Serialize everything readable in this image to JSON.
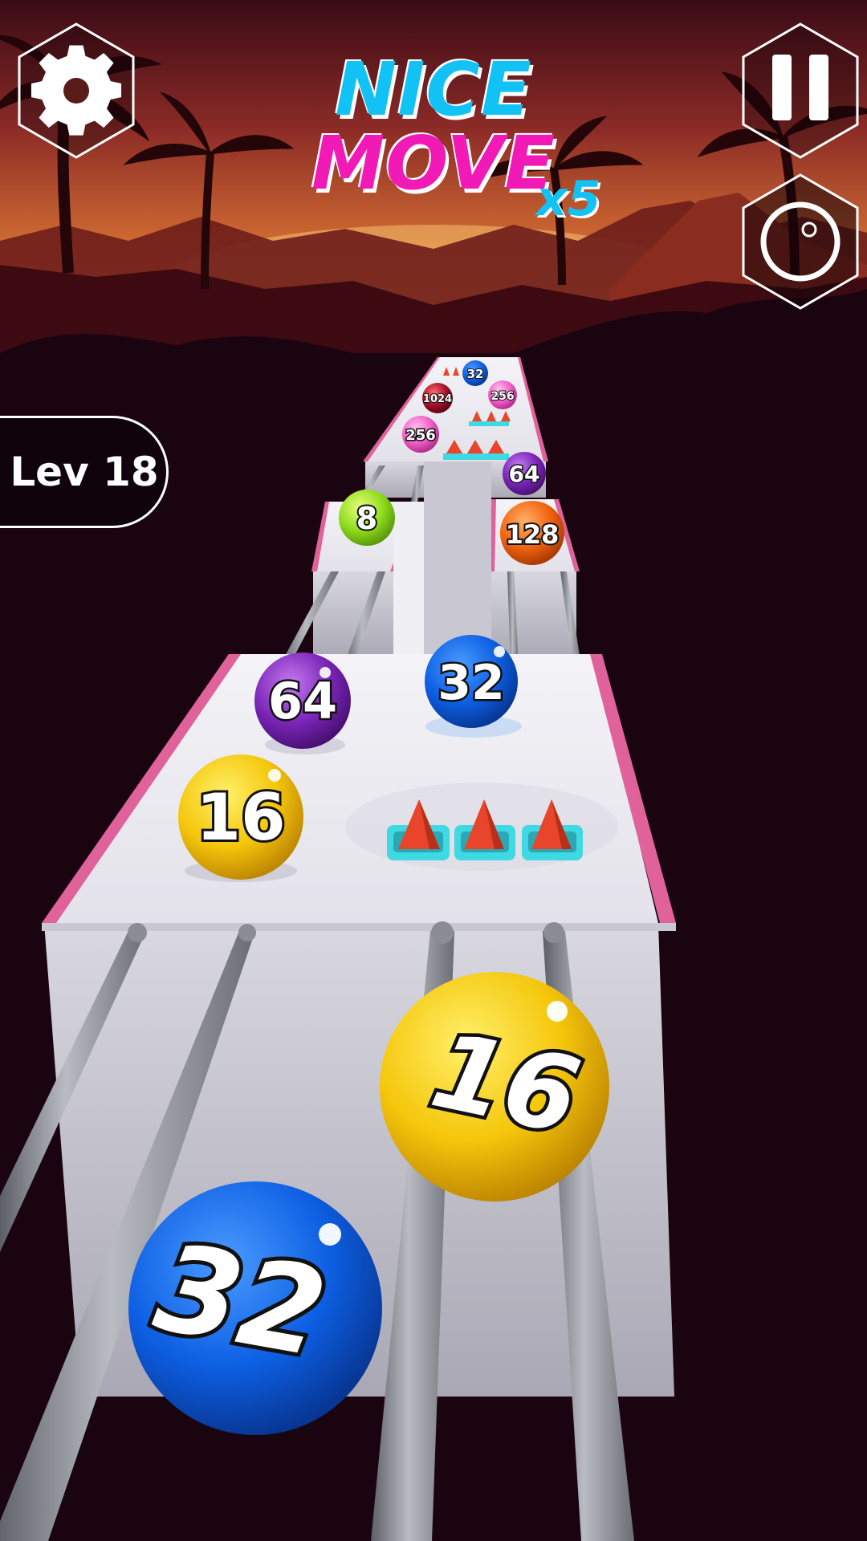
{
  "combo": {
    "line1": "NICE",
    "line2": "MOVE",
    "multiplier": "x5"
  },
  "level": {
    "label": "Lev 18"
  },
  "buttons": {
    "settings": "gear-icon",
    "pause": "pause-icon",
    "vibration": "vibration-icon"
  },
  "colors": {
    "sky_top": "#3a0b16",
    "sky_horizon": "#f3a33c",
    "ground": "#1a0410",
    "track_rail": "#e0629b",
    "combo_cyan": "#13c2f5",
    "combo_magenta": "#f11ab6",
    "spike": "#e8452b",
    "spike_base": "#3fd9e3"
  },
  "balls": [
    {
      "id": "far-32",
      "value": "32",
      "color": "#1456d8"
    },
    {
      "id": "far-1024",
      "value": "1024",
      "color": "#a3102a"
    },
    {
      "id": "far-256-a",
      "value": "256",
      "color": "#f25fc9"
    },
    {
      "id": "far-256-b",
      "value": "256",
      "color": "#f25fc9"
    },
    {
      "id": "mid-64",
      "value": "64",
      "color": "#7a25b8"
    },
    {
      "id": "mid-8",
      "value": "8",
      "color": "#8fdc1d"
    },
    {
      "id": "mid-128",
      "value": "128",
      "color": "#f0630f"
    },
    {
      "id": "near-64",
      "value": "64",
      "color": "#7a25b8"
    },
    {
      "id": "near-32",
      "value": "32",
      "color": "#1456d8"
    },
    {
      "id": "near-16",
      "value": "16",
      "color": "#e6b40a"
    },
    {
      "id": "player-16",
      "value": "16",
      "color": "#f5c60b"
    },
    {
      "id": "player-32",
      "value": "32",
      "color": "#0d5fe3"
    }
  ]
}
